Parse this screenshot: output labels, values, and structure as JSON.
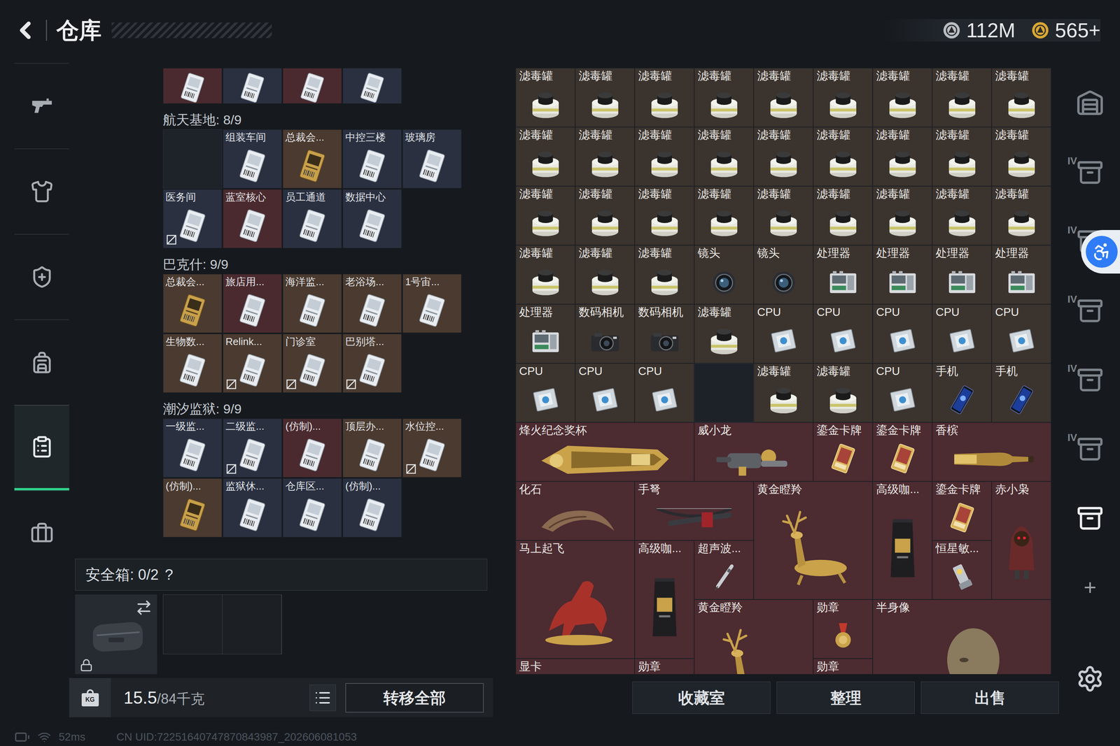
{
  "header": {
    "title": "仓库",
    "currencies": [
      {
        "amount": "112M",
        "color": "#b9bec4"
      },
      {
        "amount": "565+",
        "color": "#d9a733"
      }
    ]
  },
  "left_rail": [
    {
      "kind": "gun",
      "selected": false
    },
    {
      "kind": "armor",
      "selected": false
    },
    {
      "kind": "rig",
      "selected": false
    },
    {
      "kind": "backpack",
      "selected": false
    },
    {
      "kind": "storage",
      "selected": true
    },
    {
      "kind": "case",
      "selected": false
    }
  ],
  "keys": {
    "cut_row": [
      {
        "color": "#4a2a2e"
      },
      {
        "color": "#2a3040"
      },
      {
        "color": "#4a2a2e"
      },
      {
        "color": "#2a3040"
      }
    ],
    "groups": [
      {
        "title": "航天基地: 8/9",
        "slots": [
          {
            "kind": "empty",
            "color": "#1e232a"
          },
          {
            "name": "组装车间",
            "kind": "silver",
            "color": "#2a3040",
            "marked": false
          },
          {
            "name": "总裁会...",
            "kind": "gold",
            "color": "#4a3a2f",
            "marked": false
          },
          {
            "name": "中控三楼",
            "kind": "silver",
            "color": "#2a3040",
            "marked": false
          },
          {
            "name": "玻璃房",
            "kind": "silver",
            "color": "#2a3040",
            "marked": false
          },
          {
            "name": "医务间",
            "kind": "silver",
            "color": "#2a3040",
            "marked": true
          },
          {
            "name": "蓝室核心",
            "kind": "silver",
            "color": "#4a2a2e",
            "marked": false
          },
          {
            "name": "员工通道",
            "kind": "silver",
            "color": "#2a3040",
            "marked": false
          },
          {
            "name": "数据中心",
            "kind": "silver",
            "color": "#2a3040",
            "marked": false
          }
        ]
      },
      {
        "title": "巴克什: 9/9",
        "slots": [
          {
            "name": "总裁会...",
            "kind": "gold",
            "color": "#4a3a2f",
            "marked": false
          },
          {
            "name": "旅店用...",
            "kind": "silver",
            "color": "#4a2a2e",
            "marked": false
          },
          {
            "name": "海洋监...",
            "kind": "silver",
            "color": "#4a3a2f",
            "marked": false
          },
          {
            "name": "老浴场...",
            "kind": "silver",
            "color": "#4a3a2f",
            "marked": false
          },
          {
            "name": "1号宙...",
            "kind": "silver",
            "color": "#4a3a2f",
            "marked": false
          },
          {
            "name": "生物数...",
            "kind": "silver",
            "color": "#4a3a2f",
            "marked": false
          },
          {
            "name": "Relink...",
            "kind": "silver",
            "color": "#4a3a2f",
            "marked": true
          },
          {
            "name": "门诊室",
            "kind": "silver",
            "color": "#4a3a2f",
            "marked": true
          },
          {
            "name": "巴别塔...",
            "kind": "silver",
            "color": "#4a3a2f",
            "marked": true
          }
        ]
      },
      {
        "title": "潮汐监狱: 9/9",
        "slots": [
          {
            "name": "一级监...",
            "kind": "silver",
            "color": "#2a3040",
            "marked": false
          },
          {
            "name": "二级监...",
            "kind": "silver",
            "color": "#2a3040",
            "marked": true
          },
          {
            "name": "(仿制)...",
            "kind": "silver",
            "color": "#4a2a2e",
            "marked": false
          },
          {
            "name": "顶层办...",
            "kind": "silver",
            "color": "#4a3a2f",
            "marked": false
          },
          {
            "name": "水位控...",
            "kind": "silver",
            "color": "#4a3a2f",
            "marked": true
          },
          {
            "name": "(仿制)...",
            "kind": "gold",
            "color": "#4a3a2f",
            "marked": false
          },
          {
            "name": "监狱休...",
            "kind": "silver",
            "color": "#2a3040",
            "marked": false
          },
          {
            "name": "仓库区...",
            "kind": "silver",
            "color": "#2a3040",
            "marked": false
          },
          {
            "name": "(仿制)...",
            "kind": "silver",
            "color": "#2a3040",
            "marked": false
          }
        ]
      }
    ]
  },
  "safe_box": {
    "label": "安全箱: 0/2",
    "help": "?",
    "slots": [
      {
        "filled": false
      },
      {
        "filled": false
      }
    ]
  },
  "left_bottom": {
    "weight_icon": "KG",
    "weight": "15.5",
    "capacity": "/84千克",
    "transfer": "转移全部"
  },
  "items": [
    {
      "name": "滤毒罐",
      "kind": "filter",
      "color": "#3b332e"
    },
    {
      "name": "滤毒罐",
      "kind": "filter",
      "color": "#3b332e"
    },
    {
      "name": "滤毒罐",
      "kind": "filter",
      "color": "#3b332e"
    },
    {
      "name": "滤毒罐",
      "kind": "filter",
      "color": "#3b332e"
    },
    {
      "name": "滤毒罐",
      "kind": "filter",
      "color": "#3b332e"
    },
    {
      "name": "滤毒罐",
      "kind": "filter",
      "color": "#3b332e"
    },
    {
      "name": "滤毒罐",
      "kind": "filter",
      "color": "#3b332e"
    },
    {
      "name": "滤毒罐",
      "kind": "filter",
      "color": "#3b332e"
    },
    {
      "name": "滤毒罐",
      "kind": "filter",
      "color": "#3b332e"
    },
    {
      "name": "滤毒罐",
      "kind": "filter",
      "color": "#3b332e"
    },
    {
      "name": "滤毒罐",
      "kind": "filter",
      "color": "#3b332e"
    },
    {
      "name": "滤毒罐",
      "kind": "filter",
      "color": "#3b332e"
    },
    {
      "name": "滤毒罐",
      "kind": "filter",
      "color": "#3b332e"
    },
    {
      "name": "滤毒罐",
      "kind": "filter",
      "color": "#3b332e"
    },
    {
      "name": "滤毒罐",
      "kind": "filter",
      "color": "#3b332e"
    },
    {
      "name": "滤毒罐",
      "kind": "filter",
      "color": "#3b332e"
    },
    {
      "name": "滤毒罐",
      "kind": "filter",
      "color": "#3b332e"
    },
    {
      "name": "滤毒罐",
      "kind": "filter",
      "color": "#3b332e"
    },
    {
      "name": "滤毒罐",
      "kind": "filter",
      "color": "#3b332e"
    },
    {
      "name": "滤毒罐",
      "kind": "filter",
      "color": "#3b332e"
    },
    {
      "name": "滤毒罐",
      "kind": "filter",
      "color": "#3b332e"
    },
    {
      "name": "滤毒罐",
      "kind": "filter",
      "color": "#3b332e"
    },
    {
      "name": "滤毒罐",
      "kind": "filter",
      "color": "#3b332e"
    },
    {
      "name": "滤毒罐",
      "kind": "filter",
      "color": "#3b332e"
    },
    {
      "name": "滤毒罐",
      "kind": "filter",
      "color": "#3b332e"
    },
    {
      "name": "滤毒罐",
      "kind": "filter",
      "color": "#3b332e"
    },
    {
      "name": "滤毒罐",
      "kind": "filter",
      "color": "#3b332e"
    },
    {
      "name": "滤毒罐",
      "kind": "filter",
      "color": "#3b332e"
    },
    {
      "name": "滤毒罐",
      "kind": "filter",
      "color": "#3b332e"
    },
    {
      "name": "滤毒罐",
      "kind": "filter",
      "color": "#3b332e"
    },
    {
      "name": "镜头",
      "kind": "lens",
      "color": "#3b332e"
    },
    {
      "name": "镜头",
      "kind": "lens",
      "color": "#3b332e"
    },
    {
      "name": "处理器",
      "kind": "processor",
      "color": "#3b332e"
    },
    {
      "name": "处理器",
      "kind": "processor",
      "color": "#3b332e"
    },
    {
      "name": "处理器",
      "kind": "processor",
      "color": "#3b332e"
    },
    {
      "name": "处理器",
      "kind": "processor",
      "color": "#3b332e"
    },
    {
      "name": "处理器",
      "kind": "processor",
      "color": "#3b332e"
    },
    {
      "name": "数码相机",
      "kind": "camera",
      "color": "#3b332e"
    },
    {
      "name": "数码相机",
      "kind": "camera",
      "color": "#3b332e"
    },
    {
      "name": "滤毒罐",
      "kind": "filter",
      "color": "#3b332e"
    },
    {
      "name": "CPU",
      "kind": "cpu",
      "color": "#3b332e"
    },
    {
      "name": "CPU",
      "kind": "cpu",
      "color": "#3b332e"
    },
    {
      "name": "CPU",
      "kind": "cpu",
      "color": "#3b332e"
    },
    {
      "name": "CPU",
      "kind": "cpu",
      "color": "#3b332e"
    },
    {
      "name": "CPU",
      "kind": "cpu",
      "color": "#3b332e"
    },
    {
      "name": "CPU",
      "kind": "cpu",
      "color": "#3b332e"
    },
    {
      "name": "CPU",
      "kind": "cpu",
      "color": "#3b332e"
    },
    {
      "name": "CPU",
      "kind": "cpu",
      "color": "#3b332e"
    },
    {
      "name": "",
      "kind": "empty",
      "color": "#1d2229"
    },
    {
      "name": "滤毒罐",
      "kind": "filter",
      "color": "#3b332e"
    },
    {
      "name": "滤毒罐",
      "kind": "filter",
      "color": "#3b332e"
    },
    {
      "name": "CPU",
      "kind": "cpu",
      "color": "#3b332e"
    },
    {
      "name": "手机",
      "kind": "phone",
      "color": "#3b332e"
    },
    {
      "name": "手机",
      "kind": "phone",
      "color": "#3b332e"
    },
    {
      "name": "烽火纪念奖杯",
      "kind": "trophy",
      "color": "#4c2b31"
    },
    {
      "name": "威小龙",
      "kind": "figure",
      "color": "#4c2b31"
    },
    {
      "name": "鎏金卡牌",
      "kind": "card",
      "color": "#4c2b31"
    },
    {
      "name": "鎏金卡牌",
      "kind": "card",
      "color": "#4c2b31"
    },
    {
      "name": "香槟",
      "kind": "bottle",
      "color": "#4c2b31"
    },
    {
      "name": "化石",
      "kind": "fossil",
      "color": "#4c2b31"
    },
    {
      "name": "手弩",
      "kind": "crossbow",
      "color": "#4c2b31"
    },
    {
      "name": "黄金瞪羚",
      "kind": "statue",
      "color": "#4c2b31"
    },
    {
      "name": "高级咖...",
      "kind": "coffee",
      "color": "#4c2b31"
    },
    {
      "name": "鎏金卡牌",
      "kind": "card",
      "color": "#4c2b31"
    },
    {
      "name": "赤小枭",
      "kind": "owl",
      "color": "#4c2b31"
    },
    {
      "name": "马上起飞",
      "kind": "horse",
      "color": "#4c2b31"
    },
    {
      "name": "高级咖...",
      "kind": "coffee",
      "color": "#4c2b31"
    },
    {
      "name": "超声波...",
      "kind": "pen",
      "color": "#4c2b31"
    },
    {
      "name": "恒星敏...",
      "kind": "device",
      "color": "#4c2b31"
    },
    {
      "name": "黄金瞪羚",
      "kind": "statue",
      "color": "#4c2b31"
    },
    {
      "name": "勋章",
      "kind": "medal",
      "color": "#4c2b31"
    },
    {
      "name": "半身像",
      "kind": "bust",
      "color": "#4c2b31"
    },
    {
      "name": "显卡",
      "kind": "gpu",
      "color": "#4c2b31"
    },
    {
      "name": "勋章",
      "kind": "medal",
      "color": "#4c2b31"
    },
    {
      "name": "勋章",
      "kind": "medal",
      "color": "#4c2b31"
    }
  ],
  "actions": [
    "收藏室",
    "整理",
    "出售"
  ],
  "right_rail": {
    "items": [
      {
        "kind": "home",
        "badge": "",
        "selected": false
      },
      {
        "kind": "box",
        "badge": "IV",
        "selected": false
      },
      {
        "kind": "box",
        "badge": "IV",
        "selected": false
      },
      {
        "kind": "box",
        "badge": "IV",
        "selected": false
      },
      {
        "kind": "box",
        "badge": "IV",
        "selected": false
      },
      {
        "kind": "box",
        "badge": "IV",
        "selected": false
      },
      {
        "kind": "box",
        "badge": "",
        "selected": true
      }
    ],
    "add": "+"
  },
  "footer": {
    "ping": "52ms",
    "uid": "CN UID:72251640747870843987_202606081053"
  }
}
